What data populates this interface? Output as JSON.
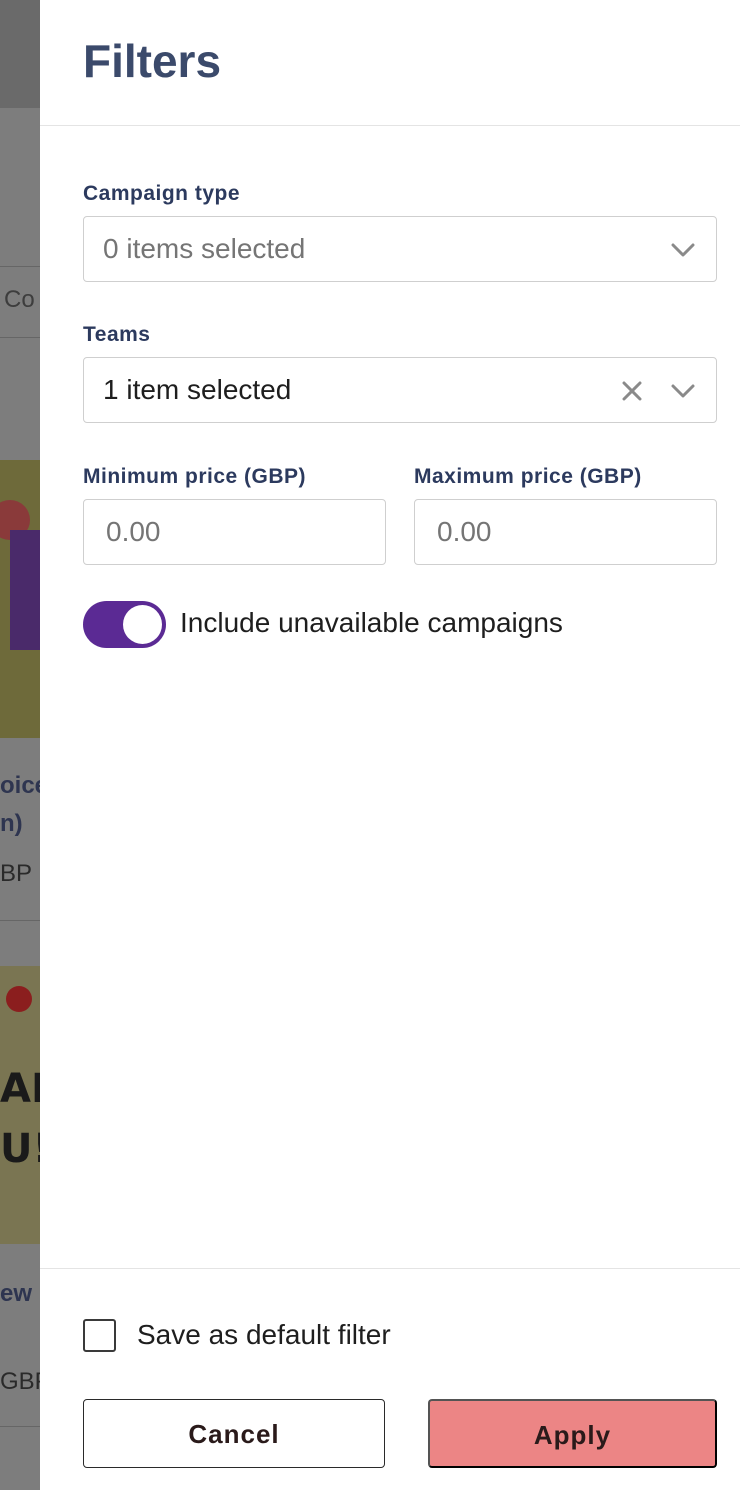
{
  "background": {
    "fragments": [
      "Co",
      "oice",
      "n)",
      "BP",
      "AN",
      "U!",
      "ew",
      "GBP"
    ]
  },
  "drawer": {
    "title": "Filters",
    "campaign_type": {
      "label": "Campaign type",
      "value": "0 items selected"
    },
    "teams": {
      "label": "Teams",
      "value": "1 item selected"
    },
    "min_price": {
      "label": "Minimum price (GBP)",
      "placeholder": "0.00"
    },
    "max_price": {
      "label": "Maximum price (GBP)",
      "placeholder": "0.00"
    },
    "include_unavailable": {
      "label": "Include unavailable campaigns",
      "checked": true
    },
    "save_default": {
      "label": "Save as default filter",
      "checked": false
    },
    "buttons": {
      "cancel": "Cancel",
      "apply": "Apply"
    }
  },
  "colors": {
    "title": "#3b4a6b",
    "toggle_on": "#5b2a94",
    "apply_button": "#ec8585",
    "overlay": "#7d7d7d"
  },
  "icons": [
    "chevron-down-icon",
    "close-icon"
  ]
}
